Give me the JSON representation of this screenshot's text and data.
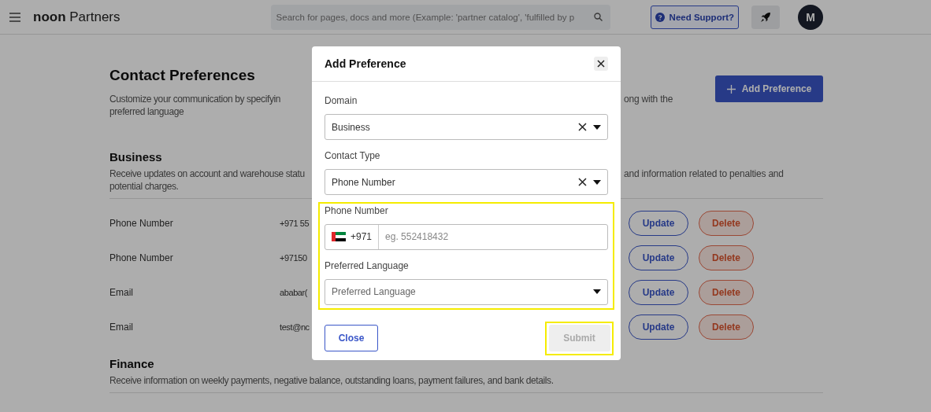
{
  "header": {
    "logo_bold": "noon",
    "logo_rest": "Partners",
    "search": {
      "placeholder": "Search for pages, docs and more (Example: 'partner catalog', 'fulfilled by p"
    },
    "support_button": "Need Support?",
    "avatar": "M"
  },
  "page": {
    "title": "Contact Preferences",
    "description_left": [
      "Customize your communication by specifyin",
      "preferred language"
    ],
    "description_right": "ong with the",
    "add_button": "Add Preference"
  },
  "sections": [
    {
      "title": "Business",
      "description_left": [
        "Receive updates on account and warehouse statu",
        "potential charges."
      ],
      "description_right": "and information related to penalties and",
      "rows": [
        {
          "type": "Phone Number",
          "value": "+971 55",
          "update": "Update",
          "delete": "Delete"
        },
        {
          "type": "Phone Number",
          "value": "+97150",
          "update": "Update",
          "delete": "Delete"
        },
        {
          "type": "Email",
          "value": "ababar(",
          "update": "Update",
          "delete": "Delete"
        },
        {
          "type": "Email",
          "value": "test@nc",
          "update": "Update",
          "delete": "Delete"
        }
      ]
    },
    {
      "title": "Finance",
      "description_left": [
        "Receive information on weekly payments, negative balance, outstanding loans, payment failures, and bank details."
      ]
    }
  ],
  "modal": {
    "title": "Add Preference",
    "fields": [
      {
        "kind": "select",
        "label": "Domain",
        "value": "Business",
        "clearable": true,
        "highlighted": false
      },
      {
        "kind": "select",
        "label": "Contact Type",
        "value": "Phone Number",
        "clearable": true,
        "highlighted": false
      },
      {
        "kind": "phone",
        "label": "Phone Number",
        "code": "+971",
        "placeholder": "eg. 552418432",
        "highlighted": true
      },
      {
        "kind": "select",
        "label": "Preferred Language",
        "placeholder": "Preferred Language",
        "clearable": false,
        "highlighted": true
      }
    ],
    "close_button": "Close",
    "submit_button": {
      "label": "Submit",
      "disabled": true,
      "highlighted": true
    }
  }
}
